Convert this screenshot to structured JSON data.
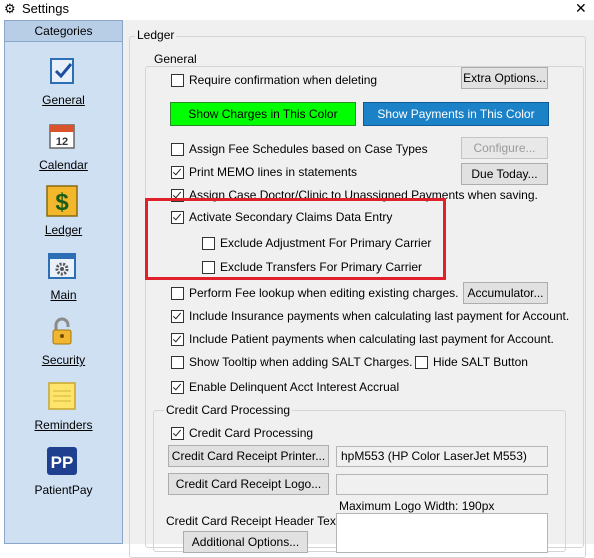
{
  "window": {
    "title": "Settings",
    "close_glyph": "✕"
  },
  "sidebar": {
    "header": "Categories",
    "items": [
      {
        "label": "General",
        "icon": "checkmark-document-icon"
      },
      {
        "label": "Calendar",
        "icon": "calendar-icon",
        "date": "12"
      },
      {
        "label": "Ledger",
        "icon": "dollar-icon",
        "glyph": "$"
      },
      {
        "label": "Main",
        "icon": "gear-window-icon"
      },
      {
        "label": "Security",
        "icon": "padlock-icon"
      },
      {
        "label": "Reminders",
        "icon": "sticky-note-icon"
      },
      {
        "label": "PatientPay",
        "icon": "patientpay-logo-icon",
        "glyph": "PP"
      }
    ]
  },
  "ledger": {
    "group_title": "Ledger",
    "general": {
      "title": "General",
      "require_confirmation": {
        "label": "Require confirmation when deleting",
        "checked": false
      },
      "extra_options": "Extra Options...",
      "show_charges": "Show Charges in This Color",
      "show_payments": "Show Payments in This Color",
      "charges_color": "#00ff00",
      "payments_color": "#1c82c8",
      "assign_fee": {
        "label": "Assign Fee Schedules based on Case Types",
        "checked": false
      },
      "configure": "Configure...",
      "print_memo": {
        "label": "Print MEMO lines in statements",
        "checked": true
      },
      "due_today": "Due Today...",
      "assign_case": {
        "label": "Assign Case Doctor/Clinic to Unassigned Payments when saving.",
        "checked": true
      },
      "activate_secondary": {
        "label": "Activate Secondary Claims Data Entry",
        "checked": true
      },
      "exclude_adjustment": {
        "label": "Exclude Adjustment For Primary Carrier",
        "checked": false
      },
      "exclude_transfers": {
        "label": "Exclude Transfers For Primary Carrier",
        "checked": false
      },
      "fee_lookup": {
        "label": "Perform Fee lookup when editing existing charges.",
        "checked": false
      },
      "accumulator": "Accumulator...",
      "include_insurance": {
        "label": "Include Insurance payments when calculating last payment for Account.",
        "checked": true
      },
      "include_patient": {
        "label": "Include Patient payments when calculating last payment for Account.",
        "checked": true
      },
      "show_tooltip": {
        "label": "Show Tooltip when adding SALT Charges.",
        "checked": false
      },
      "hide_salt": {
        "label": "Hide SALT Button",
        "checked": false
      },
      "enable_delinquent": {
        "label": "Enable Delinquent Acct Interest Accrual",
        "checked": true
      }
    },
    "credit_card": {
      "title": "Credit Card Processing",
      "enabled": {
        "label": "Credit Card Processing",
        "checked": true
      },
      "receipt_printer_button": "Credit Card Receipt Printer...",
      "receipt_printer_value": "hpM553 (HP Color LaserJet M553)",
      "receipt_logo_button": "Credit Card Receipt Logo...",
      "receipt_logo_value": "",
      "max_logo_width": "Maximum Logo Width: 190px",
      "header_text_label": "Credit Card Receipt Header Text:",
      "header_text_value": "",
      "additional_options": "Additional Options..."
    }
  },
  "annotation_color": "#e0202a"
}
